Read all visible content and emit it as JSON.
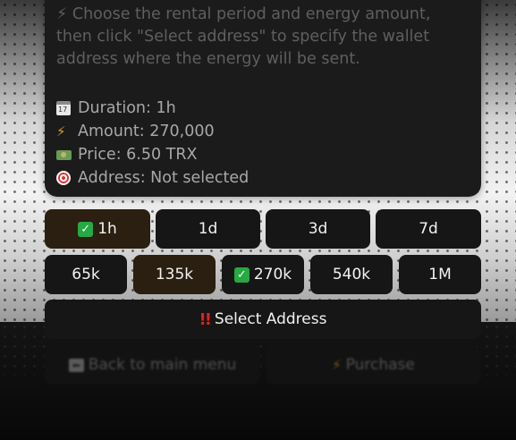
{
  "message": {
    "description": "⚡ Choose the rental period and energy amount, then click \"Select address\" to specify the wallet address where the energy will be sent.",
    "info": [
      {
        "icon": "calendar-icon",
        "text": "Duration: 1h"
      },
      {
        "icon": "lightning-icon",
        "text": "Amount: 270,000"
      },
      {
        "icon": "money-icon",
        "text": "Price: 6.50 TRX"
      },
      {
        "icon": "target-icon",
        "text": "Address: Not selected"
      }
    ]
  },
  "keyboard": {
    "durations": [
      {
        "label": "1h",
        "selected": true
      },
      {
        "label": "1d",
        "selected": false
      },
      {
        "label": "3d",
        "selected": false
      },
      {
        "label": "7d",
        "selected": false
      }
    ],
    "amounts": [
      {
        "label": "65k",
        "selected": false
      },
      {
        "label": "135k",
        "selected": false,
        "highlighted": true
      },
      {
        "label": "270k",
        "selected": true
      },
      {
        "label": "540k",
        "selected": false
      },
      {
        "label": "1M",
        "selected": false
      }
    ],
    "select_address": "Select Address",
    "select_address_icon": "double-exclamation-icon",
    "back": "Back to main menu",
    "back_icon": "back-arrow-icon",
    "purchase": "Purchase",
    "purchase_icon": "lightning-icon"
  },
  "colors": {
    "bubble": "#1b1b1b",
    "button": "#161616",
    "button_selected": "#2a1f10",
    "check": "#27a943",
    "text_muted": "#a8a8a8"
  }
}
